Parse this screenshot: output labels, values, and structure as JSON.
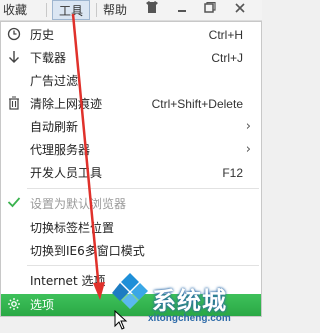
{
  "menubar": {
    "items": [
      "收藏",
      "工具",
      "帮助"
    ],
    "active": "工具"
  },
  "window_controls": [
    "shirt-icon",
    "minimize-icon",
    "restore-icon",
    "close-icon"
  ],
  "menu": {
    "items": [
      {
        "label": "历史",
        "shortcut": "Ctrl+H",
        "icon": "history-clock-icon"
      },
      {
        "label": "下载器",
        "shortcut": "Ctrl+J",
        "icon": "download-arrow-icon"
      },
      {
        "label": "广告过滤",
        "shortcut": "",
        "icon": ""
      },
      {
        "label": "清除上网痕迹",
        "shortcut": "Ctrl+Shift+Delete",
        "icon": "trash-icon"
      },
      {
        "label": "自动刷新",
        "shortcut": "",
        "icon": "",
        "submenu": true
      },
      {
        "label": "代理服务器",
        "shortcut": "",
        "icon": "",
        "submenu": true
      },
      {
        "label": "开发人员工具",
        "shortcut": "F12",
        "icon": ""
      },
      {
        "label": "设置为默认浏览器",
        "shortcut": "",
        "icon": "checkmark-icon",
        "disabled": true
      },
      {
        "label": "切换标签栏位置",
        "shortcut": "",
        "icon": ""
      },
      {
        "label": "切换到IE6多窗口模式",
        "shortcut": "",
        "icon": ""
      },
      {
        "label": "Internet 选项",
        "shortcut": "",
        "icon": ""
      },
      {
        "label": "选项",
        "shortcut": "",
        "icon": "gear-icon",
        "highlighted": true
      }
    ]
  },
  "watermark": {
    "text": "系统城",
    "url": "xitongcheng.com"
  },
  "colors": {
    "highlight": "#2fb14c",
    "annotation_arrow": "#e0312b",
    "watermark_blue": "#2c6aa8"
  }
}
